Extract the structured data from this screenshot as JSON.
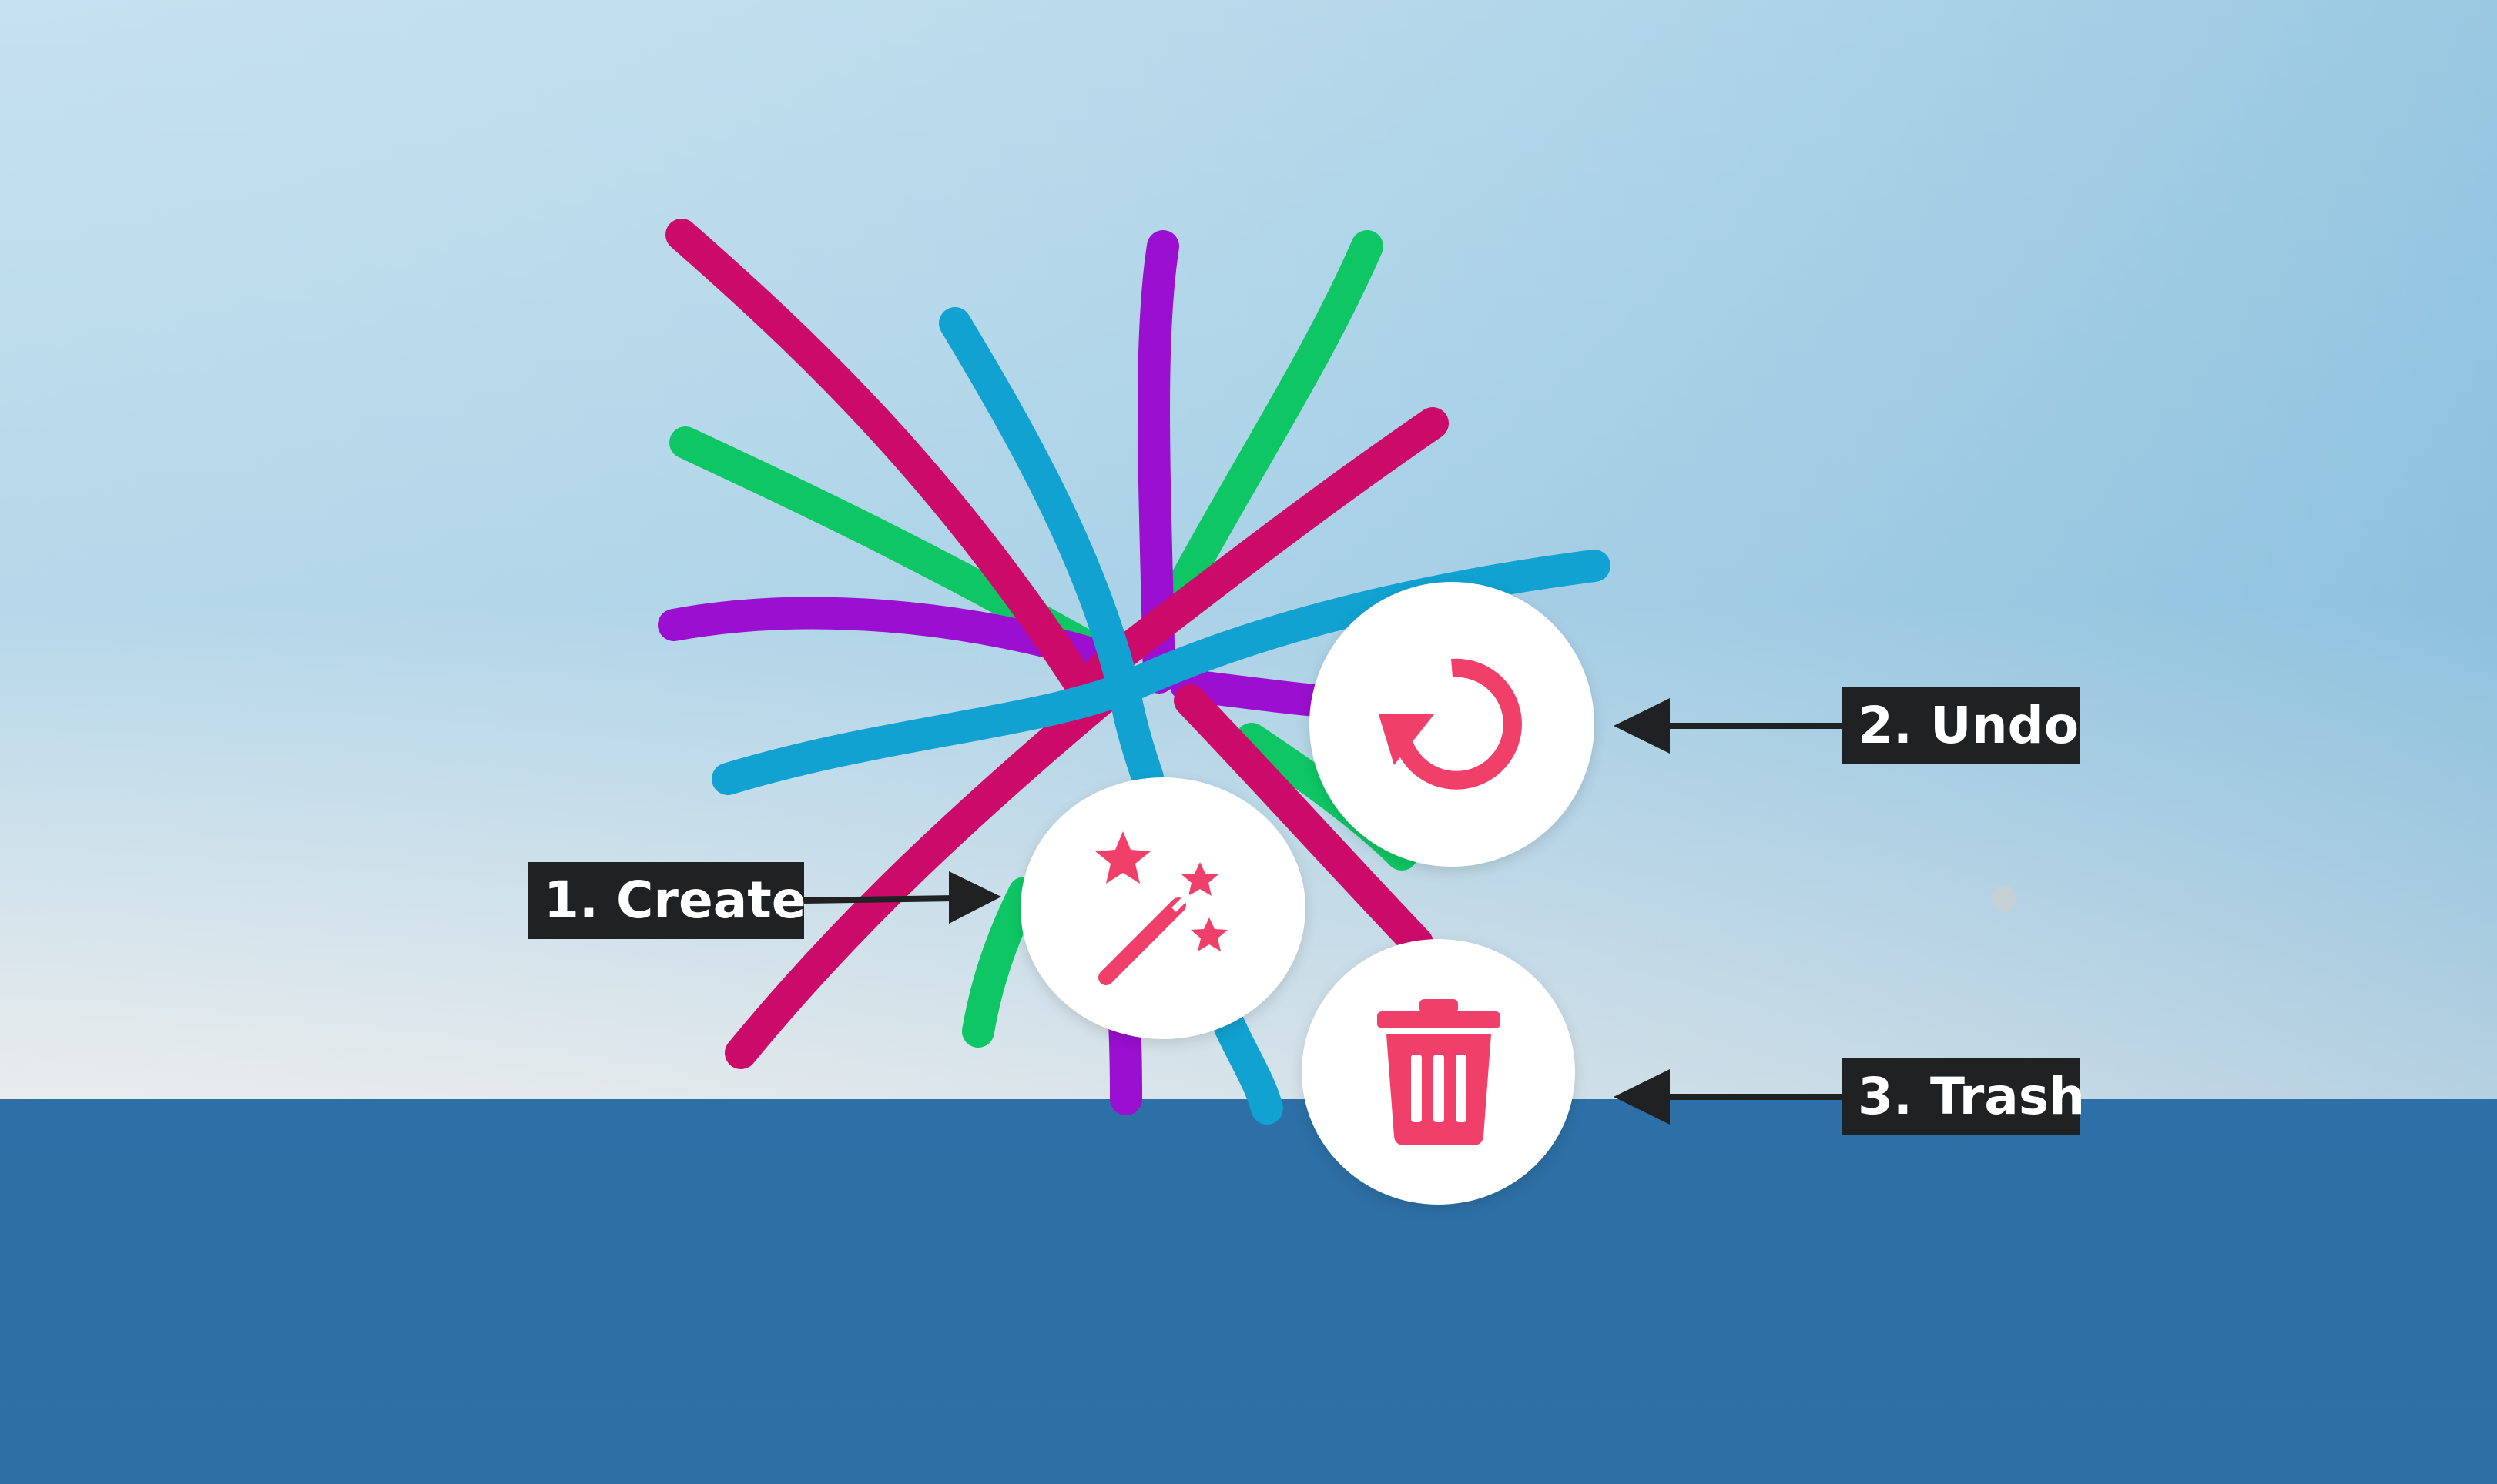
{
  "scene": {
    "sky_top_color": "#b9dcec",
    "sky_bottom_color": "#e4e8ea",
    "ground_color": "#2c6fa6",
    "stroke_colors": [
      "#cc0a6a",
      "#9a0fd0",
      "#0ec764",
      "#11a2d1"
    ]
  },
  "toolbar": {
    "create": {
      "icon": "magic-wand-icon",
      "label": "1. Create"
    },
    "undo": {
      "icon": "undo-icon",
      "label": "2. Undo"
    },
    "trash": {
      "icon": "trash-icon",
      "label": "3. Trash"
    },
    "icon_color": "#f0406a"
  },
  "annotation_color": "#1f2122"
}
